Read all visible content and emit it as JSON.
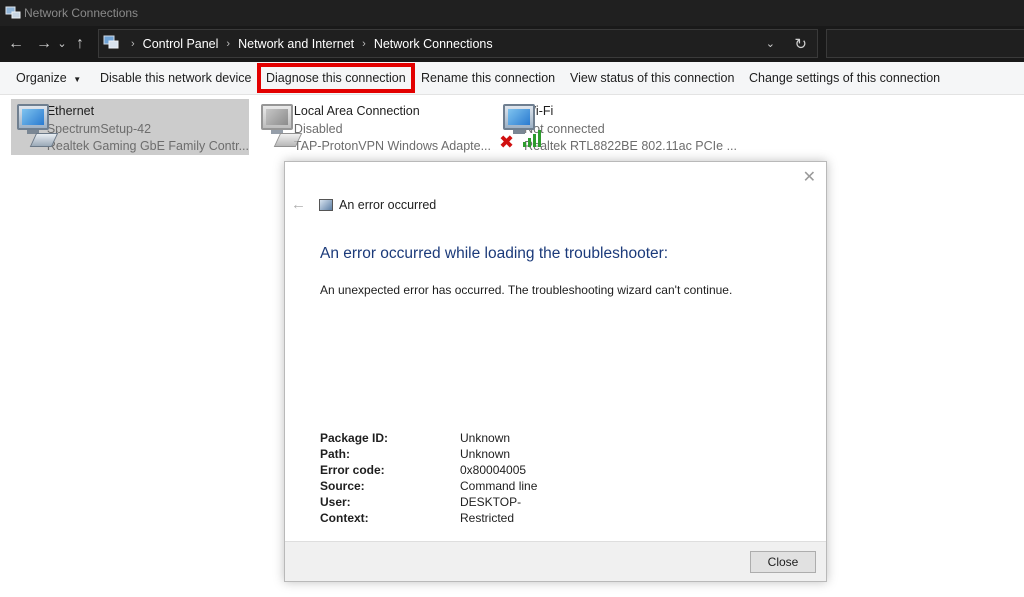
{
  "window": {
    "title": "Network Connections"
  },
  "address": {
    "crumbs": [
      "Control Panel",
      "Network and Internet",
      "Network Connections"
    ]
  },
  "commands": {
    "organize": "Organize",
    "disable": "Disable this network device",
    "diagnose": "Diagnose this connection",
    "rename": "Rename this connection",
    "view_status": "View status of this connection",
    "change_settings": "Change settings of this connection"
  },
  "connections": [
    {
      "name": "Ethernet",
      "status": "SpectrumSetup-42",
      "adapter": "Realtek Gaming GbE Family Contr..."
    },
    {
      "name": "Local Area Connection",
      "status": "Disabled",
      "adapter": "TAP-ProtonVPN Windows Adapte..."
    },
    {
      "name": "Wi-Fi",
      "status": "Not connected",
      "adapter": "Realtek RTL8822BE 802.11ac PCIe ..."
    }
  ],
  "dialog": {
    "title": "An error occurred",
    "heading": "An error occurred while loading the troubleshooter:",
    "message": "An unexpected error has occurred. The troubleshooting wizard can't continue.",
    "details": [
      {
        "label": "Package ID:",
        "value": "Unknown"
      },
      {
        "label": "Path:",
        "value": "Unknown"
      },
      {
        "label": "Error code:",
        "value": "0x80004005"
      },
      {
        "label": "Source:",
        "value": "Command line"
      },
      {
        "label": "User:",
        "value": "DESKTOP-"
      },
      {
        "label": "Context:",
        "value": "Restricted"
      }
    ],
    "close_label": "Close"
  },
  "colors": {
    "highlight": "#e30000",
    "heading": "#1b3a7a",
    "titlebar": "#202020"
  }
}
